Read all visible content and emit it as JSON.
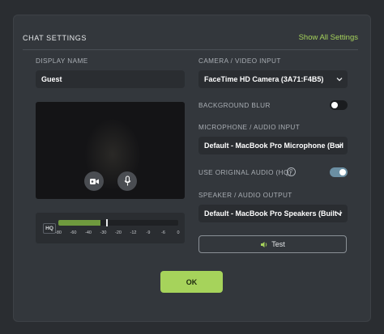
{
  "header": {
    "title": "CHAT SETTINGS",
    "link": "Show All Settings"
  },
  "display_name": {
    "label": "DISPLAY NAME",
    "value": "Guest"
  },
  "camera": {
    "label": "CAMERA / VIDEO INPUT",
    "value": "FaceTime HD Camera (3A71:F4B5)"
  },
  "blur": {
    "label": "BACKGROUND BLUR",
    "enabled": false
  },
  "microphone": {
    "label": "MICROPHONE / AUDIO INPUT",
    "value": "Default - MacBook Pro Microphone (Buil"
  },
  "original_audio": {
    "label": "USE ORIGINAL AUDIO (HQ)",
    "help": "?",
    "enabled": true
  },
  "speaker": {
    "label": "SPEAKER / AUDIO OUTPUT",
    "value": "Default - MacBook Pro Speakers (Built-i"
  },
  "meter": {
    "hq": "HQ",
    "ticks": [
      "-80",
      "-60",
      "-40",
      "-30",
      "-20",
      "-12",
      "-9",
      "-6",
      "0"
    ],
    "level_db": -32,
    "peak_db": -28
  },
  "test_label": "Test",
  "ok_label": "OK",
  "colors": {
    "accent": "#a6d35b",
    "background": "#2a2d31",
    "panel": "#33373c",
    "toggle_on": "#6b8fa3",
    "toggle_off": "#1a1c1f"
  },
  "icons": {
    "camera_toggle": "video-camera-icon",
    "mic_toggle": "microphone-icon",
    "test": "speaker-icon",
    "select": "chevron-down-icon",
    "help": "help-circle-icon"
  }
}
